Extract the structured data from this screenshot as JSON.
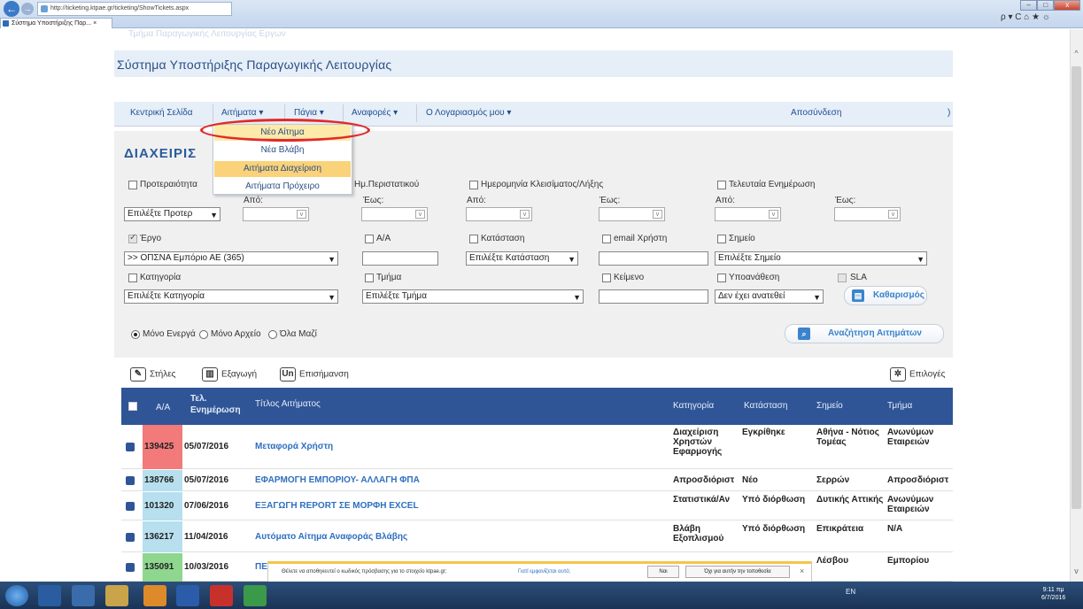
{
  "browser": {
    "url": "http://ticketing.ktpae.gr/ticketing/ShowTickets.aspx",
    "tab_title": "Σύστημα Υποστήριξης Παρ...",
    "tab_close": "×",
    "win_min": "–",
    "win_max": "□",
    "win_close": "x",
    "right_icons": "ρ ▾ C   ⌂ ★ ☼"
  },
  "header": {
    "faded_title": "Τμήμα Παραγωγικής Λειτουργίας Εργων",
    "app_title": "Σύστημα Υποστήριξης Παραγωγικής Λειτουργίας"
  },
  "nav": {
    "home": "Κεντρική Σελίδα",
    "requests": "Αιτήματα",
    "assets": "Πάγια",
    "reports": "Αναφορές",
    "account": "Ο Λογαριασμός μου",
    "logout": "Αποσύνδεση",
    "paren": ")",
    "caret": "▾"
  },
  "dropdown": {
    "items": [
      "Νέο Αίτημα",
      "Νέα Βλάβη",
      "Αιτήματα Διαχείριση",
      "Αιτήματα Πρόχειρο"
    ]
  },
  "filters": {
    "section_title": "ΔΙΑΧΕΙΡΙΣ",
    "priority": "Προτεραιότητα",
    "incident_date": "Ημ.Περιστατικού",
    "closing_date": "Ημερομηνία Κλεισίματος/Λήξης",
    "last_update": "Τελευταία Ενημέρωση",
    "from": "Από:",
    "to": "Έως:",
    "priority_select": "Επιλέξτε Προτερ",
    "project": "Έργο",
    "aa": "Α/Α",
    "status": "Κατάσταση",
    "user_email": "email Χρήστη",
    "point": "Σημείο",
    "project_select": ">> ΟΠΣΝΑ Εμπόριο ΑΕ (365)",
    "status_select": "Επιλέξτε Κατάσταση",
    "point_select": "Επιλέξτε Σημείο",
    "category": "Κατηγορία",
    "department": "Τμήμα",
    "text": "Κείμενο",
    "assignment": "Υποανάθεση",
    "sla": "SLA",
    "category_select": "Επιλέξτε Κατηγορία",
    "department_select": "Επιλέξτε Τμήμα",
    "assignment_select": "Δεν έχει ανατεθεί",
    "clear_button": "Καθαρισμός",
    "only_active": "Μόνο Ενεργά",
    "only_archive": "Μόνο Αρχείο",
    "all": "Όλα Μαζί",
    "search_button": "Αναζήτηση Αιτημάτων"
  },
  "toolbar": {
    "columns": "Στήλες",
    "export": "Εξαγωγή",
    "highlight": "Επισήμανση",
    "options": "Επιλογές"
  },
  "table": {
    "headers": {
      "aa": "Α/Α",
      "last_update_1": "Τελ.",
      "last_update_2": "Ενημέρωση",
      "title": "Τίτλος Αιτήματος",
      "category": "Κατηγορία",
      "status": "Κατάσταση",
      "point": "Σημείο",
      "department": "Τμήμα"
    },
    "rows": [
      {
        "id": "139425",
        "date": "05/07/2016",
        "title": "Μεταφορά Χρήστη",
        "category": "Διαχείριση Χρηστών Εφαρμογής",
        "status": "Εγκρίθηκε",
        "point": "Αθήνα - Νότιος Τομέας",
        "department": "Ανωνύμων Εταιρειών",
        "color": "#f27a7a"
      },
      {
        "id": "138766",
        "date": "05/07/2016",
        "title": "ΕΦΑΡΜΟΓΗ ΕΜΠΟΡΙΟΥ- ΑΛΛΑΓΗ ΦΠΑ",
        "category": "Απροσδιόριστ",
        "status": "Νέο",
        "point": "Σερρών",
        "department": "Απροσδιόριστ",
        "color": "#b7dfee"
      },
      {
        "id": "101320",
        "date": "07/06/2016",
        "title": "ΕΞΑΓΩΓΗ REPORT ΣΕ ΜΟΡΦΗ EXCEL",
        "category": "Στατιστικά/Αν",
        "status": "Υπό διόρθωση",
        "point": "Δυτικής Αττικής",
        "department": "Ανωνύμων Εταιρειών",
        "color": "#b7dfee"
      },
      {
        "id": "136217",
        "date": "11/04/2016",
        "title": "Αυτόματο Αίτημα Αναφοράς Βλάβης",
        "category": "Βλάβη Εξοπλισμού",
        "status": "Υπό διόρθωση",
        "point": "Επικράτεια",
        "department": "N/A",
        "color": "#b7dfee"
      },
      {
        "id": "135091",
        "date": "10/03/2016",
        "title": "ΠΕΙ",
        "category": "",
        "status": "",
        "point": "Λέσβου",
        "department": "Εμπορίου",
        "color": "#8fd68f"
      }
    ]
  },
  "password_bar": {
    "message": "Θέλετε να αποθηκευτεί ο κωδικός πρόσβασης για το στοιχείο ktpae.gr;",
    "why": "Γιατί εμφανίζεται αυτό;",
    "yes": "Ναι",
    "no": "Όχι για αυτήν την τοποθεσία",
    "close": "×"
  },
  "taskbar": {
    "lang": "EN",
    "time": "9:11 πμ",
    "date": "6/7/2016"
  }
}
